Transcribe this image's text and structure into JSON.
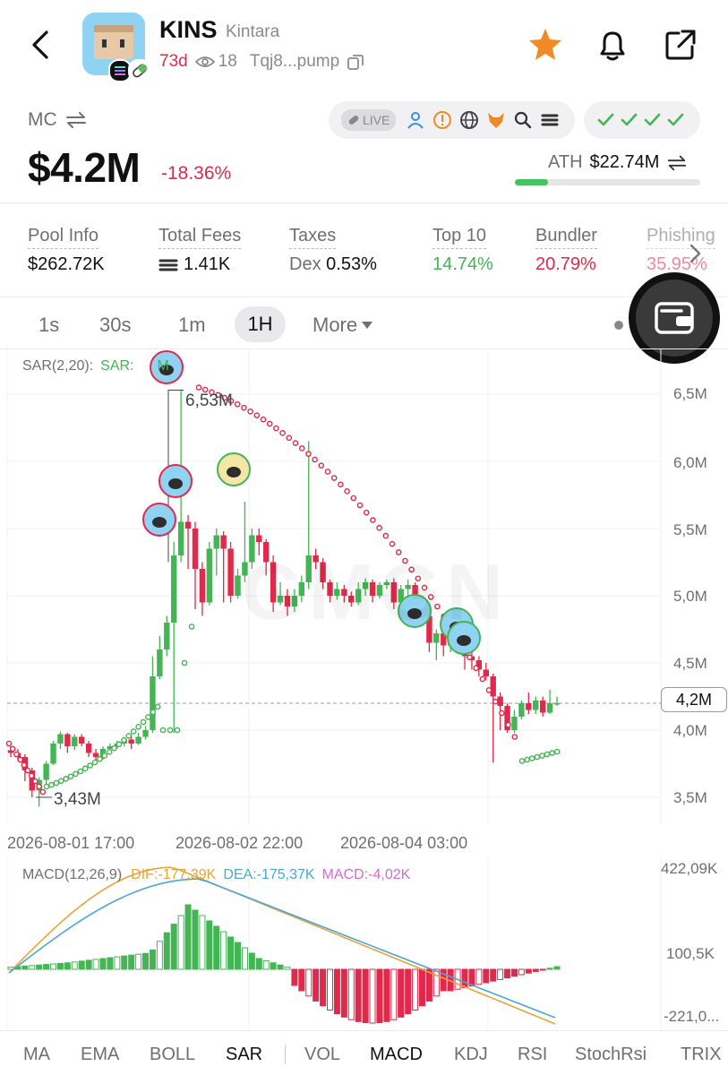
{
  "header": {
    "title": "KINS",
    "subtitle": "Kintara",
    "age": "73d",
    "watchers": "18",
    "address": "Tqj8...pump"
  },
  "market": {
    "mc_label": "MC",
    "price": "$4.2M",
    "change": "-18.36%",
    "live_label": "LIVE",
    "ath_label": "ATH",
    "ath_value": "$22.74M",
    "ath_progress": 0.18
  },
  "stats": [
    {
      "label": "Pool Info",
      "value": "$262.72K"
    },
    {
      "label": "Total Fees",
      "value": "1.41K"
    },
    {
      "label": "Taxes",
      "prefix": "Dex",
      "value": "0.53%"
    },
    {
      "label": "Top 10",
      "value": "14.74%"
    },
    {
      "label": "Bundler",
      "value": "20.79%"
    },
    {
      "label": "Phishing",
      "value": "35.95%"
    }
  ],
  "timeframes": {
    "t1": "1s",
    "t2": "30s",
    "t3": "1m",
    "t4": "1H",
    "more": "More"
  },
  "chart_data": [
    {
      "type": "candlestick",
      "indicator_label": "SAR(2,20):",
      "indicator_value": "SAR:",
      "indicator_value_tail": "M",
      "watermark": "GMGN",
      "y_ticks": [
        "6,5M",
        "6,0M",
        "5,5M",
        "5,0M",
        "4,5M",
        "4,0M",
        "3,5M"
      ],
      "current_label": "4,2M",
      "high_label": "6,53M",
      "low_label": "3,43M",
      "x_labels": [
        "2026-08-01 17:00",
        "2026-08-02 22:00",
        "2026-08-04 03:00"
      ],
      "ylim": [
        3.43,
        6.53
      ],
      "candles": [
        [
          3.85,
          3.83,
          3.88,
          3.8
        ],
        [
          3.83,
          3.8,
          3.86,
          3.78
        ],
        [
          3.8,
          3.7,
          3.82,
          3.62
        ],
        [
          3.7,
          3.55,
          3.72,
          3.5
        ],
        [
          3.55,
          3.63,
          3.65,
          3.43
        ],
        [
          3.63,
          3.75,
          3.77,
          3.6
        ],
        [
          3.75,
          3.9,
          3.92,
          3.74
        ],
        [
          3.9,
          3.97,
          3.99,
          3.86
        ],
        [
          3.97,
          3.88,
          3.98,
          3.83
        ],
        [
          3.88,
          3.95,
          3.97,
          3.85
        ],
        [
          3.95,
          3.9,
          3.97,
          3.88
        ],
        [
          3.9,
          3.83,
          3.92,
          3.8
        ],
        [
          3.83,
          3.8,
          3.86,
          3.76
        ],
        [
          3.8,
          3.86,
          3.88,
          3.78
        ],
        [
          3.86,
          3.88,
          3.9,
          3.84
        ],
        [
          3.88,
          3.9,
          3.92,
          3.86
        ],
        [
          3.9,
          3.93,
          3.95,
          3.88
        ],
        [
          3.93,
          3.9,
          3.97,
          3.86
        ],
        [
          3.9,
          3.95,
          3.98,
          3.89
        ],
        [
          3.95,
          4.0,
          4.03,
          3.93
        ],
        [
          4.0,
          4.4,
          4.55,
          3.98
        ],
        [
          4.4,
          4.6,
          4.7,
          4.38
        ],
        [
          4.6,
          4.8,
          4.85,
          4.55
        ],
        [
          4.8,
          5.3,
          5.4,
          3.98
        ],
        [
          5.3,
          5.55,
          6.53,
          5.25
        ],
        [
          5.55,
          5.5,
          5.6,
          5.2
        ],
        [
          5.5,
          5.2,
          5.55,
          4.9
        ],
        [
          5.2,
          4.95,
          5.25,
          4.85
        ],
        [
          4.95,
          5.35,
          5.4,
          4.93
        ],
        [
          5.35,
          5.45,
          5.5,
          5.15
        ],
        [
          5.45,
          5.35,
          5.48,
          4.95
        ],
        [
          5.35,
          5.0,
          5.4,
          4.95
        ],
        [
          5.0,
          5.15,
          5.2,
          4.98
        ],
        [
          5.15,
          5.25,
          5.7,
          5.1
        ],
        [
          5.25,
          5.45,
          5.5,
          5.2
        ],
        [
          5.45,
          5.4,
          5.5,
          5.3
        ],
        [
          5.4,
          5.25,
          5.42,
          5.15
        ],
        [
          5.25,
          4.95,
          5.3,
          4.88
        ],
        [
          4.95,
          5.0,
          5.1,
          4.93
        ],
        [
          5.0,
          4.92,
          5.05,
          4.85
        ],
        [
          4.92,
          5.0,
          5.05,
          4.88
        ],
        [
          5.0,
          5.1,
          5.15,
          4.95
        ],
        [
          5.1,
          5.3,
          6.15,
          5.05
        ],
        [
          5.3,
          5.25,
          5.35,
          5.2
        ],
        [
          5.25,
          5.1,
          5.28,
          5.05
        ],
        [
          5.1,
          5.0,
          5.12,
          4.95
        ],
        [
          5.0,
          5.05,
          5.1,
          4.97
        ],
        [
          5.05,
          5.0,
          5.08,
          4.95
        ],
        [
          5.0,
          4.95,
          5.03,
          4.92
        ],
        [
          4.95,
          5.05,
          5.1,
          4.93
        ],
        [
          5.05,
          5.1,
          5.13,
          5.0
        ],
        [
          5.1,
          5.0,
          5.12,
          4.95
        ],
        [
          5.0,
          5.08,
          5.1,
          4.98
        ],
        [
          5.08,
          5.1,
          5.12,
          5.05
        ],
        [
          5.1,
          4.95,
          5.13,
          4.9
        ],
        [
          4.95,
          5.05,
          5.08,
          4.93
        ],
        [
          5.05,
          5.08,
          5.12,
          5.0
        ],
        [
          5.08,
          4.97,
          5.1,
          4.93
        ],
        [
          4.97,
          4.85,
          5.0,
          4.8
        ],
        [
          4.85,
          4.65,
          4.88,
          4.58
        ],
        [
          4.65,
          4.72,
          4.75,
          4.52
        ],
        [
          4.72,
          4.63,
          4.75,
          4.55
        ],
        [
          4.63,
          4.72,
          4.78,
          4.58
        ],
        [
          4.72,
          4.75,
          4.8,
          4.65
        ],
        [
          4.75,
          4.55,
          4.78,
          4.45
        ],
        [
          4.55,
          4.52,
          4.65,
          4.45
        ],
        [
          4.52,
          4.45,
          4.55,
          4.4
        ],
        [
          4.45,
          4.4,
          4.5,
          4.37
        ],
        [
          4.4,
          4.25,
          4.42,
          3.76
        ],
        [
          4.25,
          4.18,
          4.28,
          4.0
        ],
        [
          4.18,
          4.0,
          4.2,
          3.98
        ],
        [
          4.0,
          4.1,
          4.15,
          3.98
        ],
        [
          4.1,
          4.2,
          4.22,
          4.08
        ],
        [
          4.2,
          4.15,
          4.28,
          4.12
        ],
        [
          4.15,
          4.22,
          4.25,
          4.12
        ],
        [
          4.22,
          4.13,
          4.25,
          4.1
        ],
        [
          4.13,
          4.2,
          4.3,
          4.12
        ],
        [
          4.2,
          4.2,
          4.25,
          4.18
        ]
      ]
    },
    {
      "type": "bar",
      "indicator_label": "MACD(12,26,9)",
      "dif_label": "DIF:-177,39K",
      "dea_label": "DEA:-175,37K",
      "macd_label": "MACD:-4,02K",
      "y_ticks": [
        "422,09K",
        "100,5K",
        "-221,0..."
      ]
    }
  ],
  "indicators": [
    "MA",
    "EMA",
    "BOLL",
    "SAR",
    "VOL",
    "MACD",
    "KDJ",
    "RSI",
    "StochRsi",
    "TRIX"
  ],
  "colors": {
    "up": "#44b454",
    "down": "#e0294b",
    "accent": "#f08a24"
  }
}
